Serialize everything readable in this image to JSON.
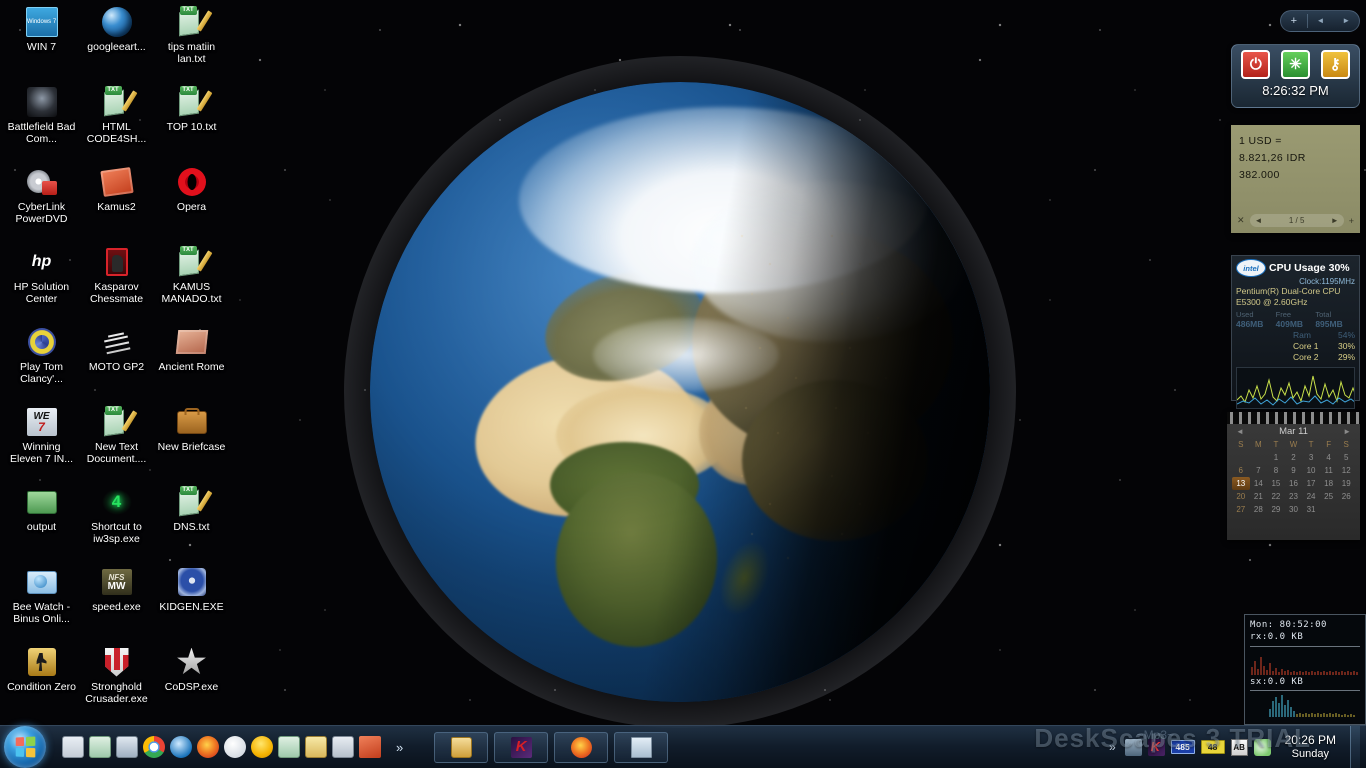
{
  "desktop": {
    "wallpaper_name": "earth-globe-space",
    "icons": [
      {
        "label": "WIN 7",
        "icon": "windows7-icon"
      },
      {
        "label": "googleeart...",
        "icon": "google-earth-icon"
      },
      {
        "label": "tips matiin lan.txt",
        "icon": "text-file-icon"
      },
      {
        "label": "Battlefield Bad Com...",
        "icon": "battlefield-game-icon"
      },
      {
        "label": "HTML CODE4SH...",
        "icon": "text-file-icon"
      },
      {
        "label": "TOP 10.txt",
        "icon": "text-file-icon"
      },
      {
        "label": "CyberLink PowerDVD",
        "icon": "powerdvd-icon"
      },
      {
        "label": "Kamus2",
        "icon": "dictionary-book-icon"
      },
      {
        "label": "Opera",
        "icon": "opera-browser-icon"
      },
      {
        "label": "HP Solution Center",
        "icon": "hp-solution-icon"
      },
      {
        "label": "Kasparov Chessmate",
        "icon": "chess-knight-icon"
      },
      {
        "label": "KAMUS MANADO.txt",
        "icon": "text-file-icon"
      },
      {
        "label": "Play Tom Clancy'...",
        "icon": "tom-clancy-icon"
      },
      {
        "label": "MOTO GP2",
        "icon": "motogp-icon"
      },
      {
        "label": "Ancient Rome",
        "icon": "ancient-rome-icon"
      },
      {
        "label": "Winning Eleven 7 IN...",
        "icon": "winning-eleven-icon"
      },
      {
        "label": "New Text Document....",
        "icon": "text-file-icon"
      },
      {
        "label": "New Briefcase",
        "icon": "briefcase-icon"
      },
      {
        "label": "output",
        "icon": "folder-icon"
      },
      {
        "label": "Shortcut to iw3sp.exe",
        "icon": "cod4-shortcut-icon"
      },
      {
        "label": "DNS.txt",
        "icon": "text-file-icon"
      },
      {
        "label": "Bee Watch - Binus Onli...",
        "icon": "bee-watch-folder-icon"
      },
      {
        "label": "speed.exe",
        "icon": "nfs-most-wanted-icon"
      },
      {
        "label": "KIDGEN.EXE",
        "icon": "kidgen-disc-icon"
      },
      {
        "label": "Condition Zero",
        "icon": "counter-strike-icon"
      },
      {
        "label": "Stronghold Crusader.exe",
        "icon": "stronghold-shield-icon"
      },
      {
        "label": "CoDSP.exe",
        "icon": "cod-star-icon"
      }
    ]
  },
  "sidebar": {
    "header": {
      "add_label": "+",
      "prev_label": "◄",
      "next_label": "►"
    },
    "power_gadget": {
      "shutdown_label": "⏻",
      "restart_label": "✳",
      "lock_label": "⚷",
      "time": "8:26:32 PM"
    },
    "notes_gadget": {
      "lines": [
        "1 USD =",
        "8.821,26 IDR",
        "382.000"
      ],
      "close_label": "✕",
      "prev_label": "◄",
      "page": "1 / 5",
      "next_label": "►",
      "add_label": "+"
    },
    "cpu_gadget": {
      "brand": "intel",
      "title": "CPU Usage",
      "usage": "30%",
      "clock": "Clock:1195MHz",
      "model_line1": "Pentium(R) Dual-Core CPU",
      "model_line2": "E5300 @ 2.60GHz",
      "mem_headers": [
        "Used",
        "Free",
        "Total"
      ],
      "mem_values": [
        "486MB",
        "409MB",
        "895MB"
      ],
      "ram_label": "Ram",
      "ram_value": "54%",
      "core1_label": "Core 1",
      "core1_value": "30%",
      "core2_label": "Core 2",
      "core2_value": "29%"
    },
    "calendar_gadget": {
      "month": "Mar 11",
      "prev_label": "◄",
      "next_label": "►",
      "day_headers": [
        "S",
        "M",
        "T",
        "W",
        "T",
        "F",
        "S"
      ],
      "leading_blanks": 2,
      "days": [
        1,
        2,
        3,
        4,
        5,
        6,
        7,
        8,
        9,
        10,
        11,
        12,
        13,
        14,
        15,
        16,
        17,
        18,
        19,
        20,
        21,
        22,
        23,
        24,
        25,
        26,
        27,
        28,
        29,
        30,
        31
      ],
      "today": 13
    },
    "network_gadget": {
      "monitor": "Mon: 80:52:00",
      "rx": "rx:0.0 KB",
      "sx": "sx:0.0 KB"
    }
  },
  "taskbar": {
    "start_label": "Start",
    "quicklaunch": [
      {
        "name": "show-desktop-icon"
      },
      {
        "name": "text-file-icon"
      },
      {
        "name": "picture-icon"
      },
      {
        "name": "chrome-icon"
      },
      {
        "name": "internet-explorer-icon"
      },
      {
        "name": "firefox-icon"
      },
      {
        "name": "messenger-icon"
      },
      {
        "name": "yahoo-messenger-icon"
      },
      {
        "name": "text-file-icon"
      },
      {
        "name": "notepad-icon"
      },
      {
        "name": "calculator-icon"
      },
      {
        "name": "dictionary-icon"
      }
    ],
    "overflow_label": "»",
    "windows": [
      {
        "name": "explorer-window",
        "icon": "folder-icon"
      },
      {
        "name": "kaspersky-window",
        "icon": "kaspersky-icon"
      },
      {
        "name": "firefox-window",
        "icon": "firefox-icon"
      },
      {
        "name": "document-window",
        "icon": "document-icon"
      }
    ],
    "tray": {
      "overflow_label": "»",
      "network_icon": "network-icon",
      "kaspersky_icon": "kaspersky-icon",
      "badge_blue": "485",
      "badge_yellow": "48",
      "ab_icon": "ab-language-icon",
      "volume_icon": "volume-icon"
    },
    "clock": {
      "time": "20:26 PM",
      "day": "Sunday"
    },
    "show_desktop_label": ""
  },
  "watermark": {
    "text": "DeskScapes 3 TRIAL",
    "secondary": "~Mp3~"
  }
}
